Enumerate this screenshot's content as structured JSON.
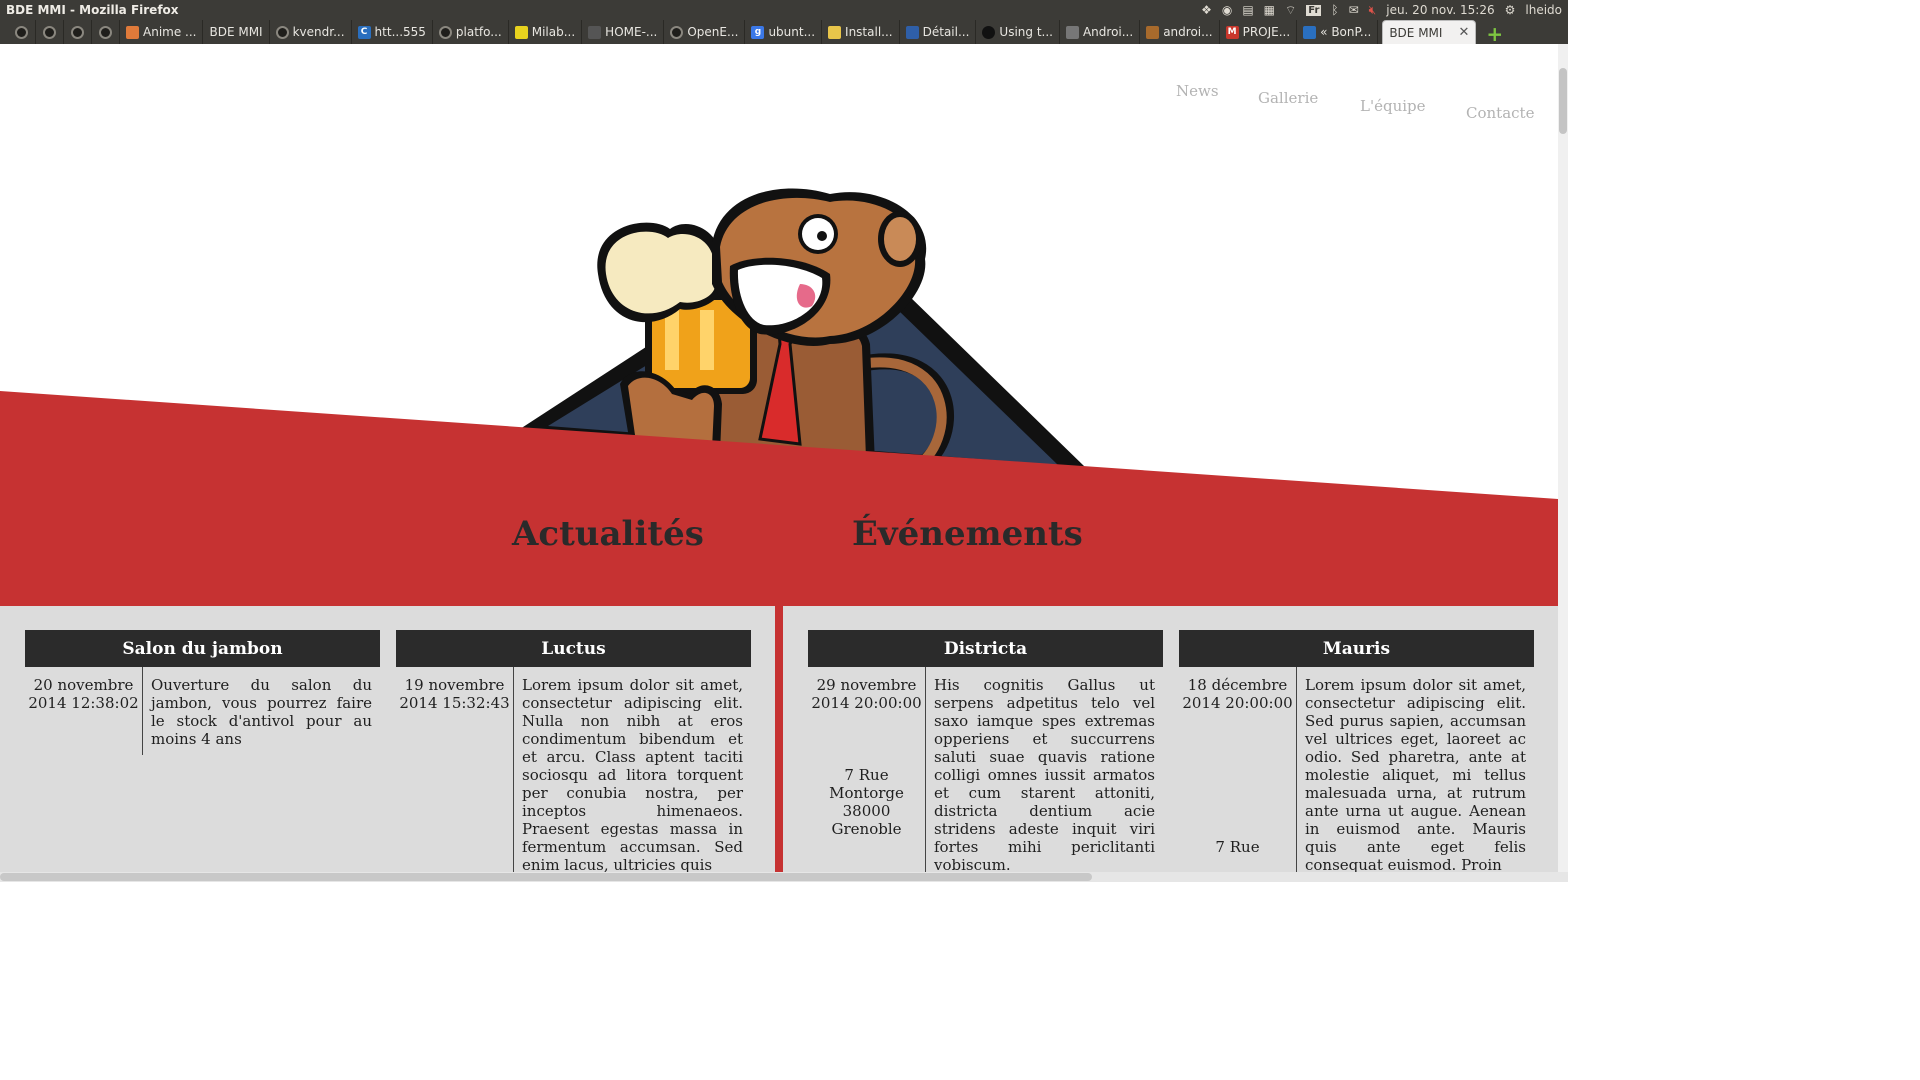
{
  "os_panel": {
    "window_title": "BDE MMI - Mozilla Firefox",
    "keyboard_layout": "Fr",
    "clock": "jeu. 20 nov. 15:26",
    "user": "lheido"
  },
  "tabs": [
    {
      "label": "",
      "icon": "github-icon",
      "pinned": true
    },
    {
      "label": "",
      "icon": "github-icon",
      "pinned": true
    },
    {
      "label": "",
      "icon": "github-icon",
      "pinned": true
    },
    {
      "label": "",
      "icon": "github-icon",
      "pinned": true
    },
    {
      "label": "Anime ...",
      "icon": "anime-site-icon"
    },
    {
      "label": "BDE MMI",
      "icon": ""
    },
    {
      "label": "kvendr...",
      "icon": "github-icon"
    },
    {
      "label": "htt...555",
      "icon": "c-site-icon"
    },
    {
      "label": "platfo...",
      "icon": "github-icon"
    },
    {
      "label": "Milab...",
      "icon": "yellow-note-icon"
    },
    {
      "label": "HOME-...",
      "icon": "home-site-icon"
    },
    {
      "label": "OpenE...",
      "icon": "github-icon"
    },
    {
      "label": "ubunt...",
      "icon": "google-icon"
    },
    {
      "label": "Install...",
      "icon": "chat-site-icon"
    },
    {
      "label": "Détail...",
      "icon": "site-icon"
    },
    {
      "label": "Using t...",
      "icon": "dark-site-icon"
    },
    {
      "label": "Androi...",
      "icon": "android-site-icon"
    },
    {
      "label": "androi...",
      "icon": "android-site-icon"
    },
    {
      "label": "PROJE...",
      "icon": "gmail-icon"
    },
    {
      "label": "« BonP...",
      "icon": "wordpress-icon"
    },
    {
      "label": "BDE MMI",
      "icon": "",
      "active": true
    }
  ],
  "nav": {
    "news": "News",
    "gallery": "Gallerie",
    "team": "L'équipe",
    "contact": "Contacte"
  },
  "colors": {
    "brand_red": "#c63232",
    "card_header": "#2b2b2b",
    "content_bg": "#dcdcdc",
    "nav_text": "#b3b3b3"
  },
  "sections": {
    "news_title": "Actualités",
    "events_title": "Événements"
  },
  "news": [
    {
      "title": "Salon du jambon",
      "date": "20 novembre 2014 12:38:02",
      "text": "Ouverture du salon du jambon, vous pourrez faire le stock d'antivol pour au moins 4 ans"
    },
    {
      "title": "Luctus",
      "date": "19 novembre 2014 15:32:43",
      "text": "Lorem ipsum dolor sit amet, consectetur adipiscing elit. Nulla non nibh at eros condimentum bibendum et et arcu. Class aptent taciti sociosqu ad litora torquent per conubia nostra, per inceptos himenaeos. Praesent egestas massa in fermentum accumsan. Sed enim lacus, ultricies quis"
    }
  ],
  "events": [
    {
      "title": "Districta",
      "date": "29 novembre 2014 20:00:00",
      "address": "7 Rue Montorge 38000 Grenoble",
      "text": "His cognitis Gallus ut serpens adpetitus telo vel saxo iamque spes extremas opperiens et succurrens saluti suae quavis ratione colligi omnes iussit armatos et cum starent attoniti, districta dentium acie stridens adeste inquit viri fortes mihi periclitanti vobiscum."
    },
    {
      "title": "Mauris",
      "date": "18 décembre 2014 20:00:00",
      "address": "7 Rue",
      "text": "Lorem ipsum dolor sit amet, consectetur adipiscing elit. Sed purus sapien, accumsan vel ultrices eget, laoreet ac odio. Sed pharetra, ante at molestie aliquet, mi tellus malesuada urna, at rutrum ante urna ut augue. Aenean in euismod ante. Mauris quis ante eget felis consequat euismod. Proin"
    }
  ]
}
